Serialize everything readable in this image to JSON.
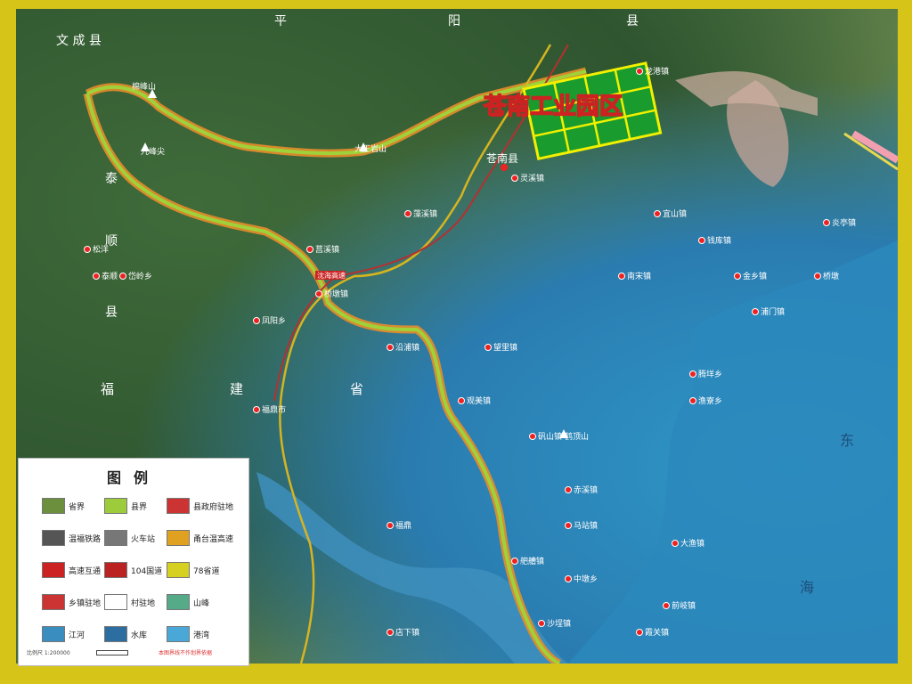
{
  "map": {
    "title": "苍南工业园区",
    "county_seat": "苍南县",
    "terrain_labels": {
      "province_left": [
        "福",
        "建",
        "省"
      ],
      "county_left": [
        "泰",
        "顺",
        "县"
      ],
      "county_top": "文 成 县",
      "top_chars": [
        "平",
        "阳",
        "县"
      ],
      "sea": [
        "东",
        "海"
      ]
    },
    "peaks": [
      {
        "name": "棉峰山"
      },
      {
        "name": "大王岩山"
      },
      {
        "name": "鹤顶山"
      },
      {
        "name": "九峰尖"
      }
    ],
    "towns": [
      "灵溪镇",
      "龙港镇",
      "钱库镇",
      "金乡镇",
      "宜山镇",
      "桥墩镇",
      "矾山镇",
      "马站镇",
      "藻溪镇",
      "赤溪镇",
      "炎亭镇",
      "霞关镇",
      "大渔镇",
      "腾垟乡",
      "莒溪镇",
      "南宋镇",
      "望里镇",
      "沿浦镇",
      "岱岭乡",
      "凤阳乡",
      "松洋",
      "泰顺",
      "福鼎市",
      "浦门镇",
      "舥艚镇",
      "桥墩",
      "观美镇",
      "渔寮乡",
      "中墩乡",
      "沙埕镇",
      "店下镇",
      "福鼎",
      "前岐镇"
    ],
    "route_label": "沈海高速"
  },
  "legend": {
    "title": "图例",
    "items": [
      {
        "label": "省界",
        "color": "#6b8f3c"
      },
      {
        "label": "县界",
        "color": "#9ccc3c"
      },
      {
        "label": "县政府驻地",
        "color": "#c33"
      },
      {
        "label": "温福铁路",
        "color": "#555"
      },
      {
        "label": "火车站",
        "color": "#777"
      },
      {
        "label": "甬台温高速",
        "color": "#e0a020"
      },
      {
        "label": "高速互通",
        "color": "#c22"
      },
      {
        "label": "104国道",
        "color": "#b22"
      },
      {
        "label": "78省道",
        "color": "#d6d020"
      },
      {
        "label": "乡镇驻地",
        "color": "#c33"
      },
      {
        "label": "村驻地",
        "color": "#fff"
      },
      {
        "label": "山峰",
        "color": "#5a8"
      },
      {
        "label": "江河",
        "color": "#3a8dbf"
      },
      {
        "label": "水库",
        "color": "#2d6ea0"
      },
      {
        "label": "港湾",
        "color": "#4aa8d8"
      }
    ],
    "scale": "比例尺 1:200000",
    "note": "本图界线不作划界依据"
  }
}
